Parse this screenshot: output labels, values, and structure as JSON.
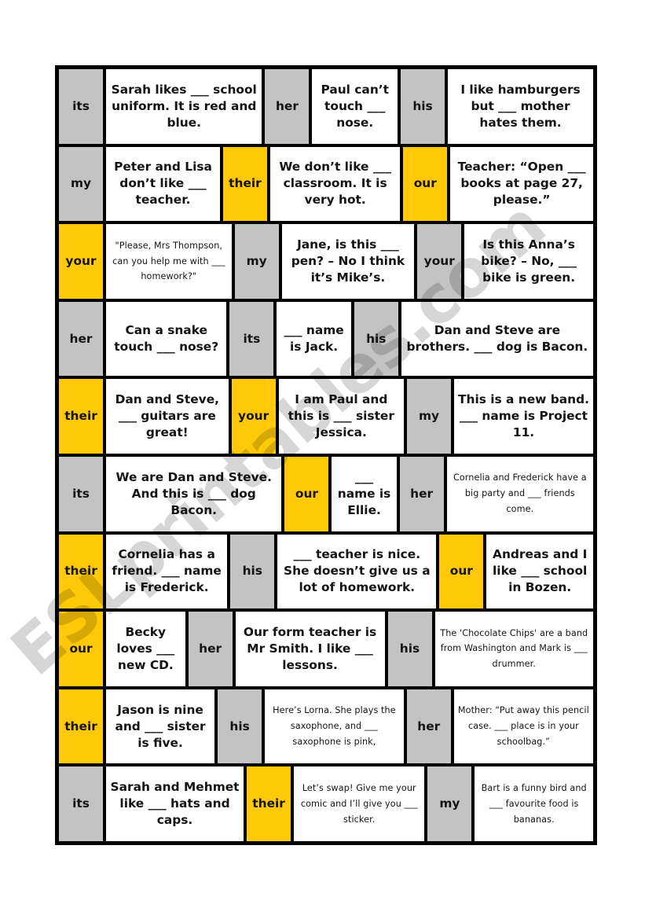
{
  "watermark": {
    "text": "ESLprintables.com"
  },
  "page": {
    "title": "Possessive adjectives domino / board cards",
    "colors": {
      "yellow": "#ffc907",
      "grey": "#c3c3c3",
      "border": "#000000",
      "white": "#ffffff"
    }
  },
  "board": {
    "columns": 6,
    "rows": [
      {
        "cells": [
          {
            "type": "word",
            "highlight": "grey",
            "text": "its"
          },
          {
            "type": "sentence",
            "size": "normal",
            "text": "Sarah likes ___ school uniform. It is red and blue."
          },
          {
            "type": "word",
            "highlight": "grey",
            "text": "her"
          },
          {
            "type": "sentence",
            "size": "normal",
            "text": "Paul can’t touch ___ nose."
          },
          {
            "type": "word",
            "highlight": "grey",
            "text": "his"
          },
          {
            "type": "sentence",
            "size": "normal",
            "text": "I like hamburgers but ___ mother hates them."
          }
        ]
      },
      {
        "cells": [
          {
            "type": "word",
            "highlight": "grey",
            "text": "my"
          },
          {
            "type": "sentence",
            "size": "normal",
            "text": "Peter and Lisa don’t like ___ teacher."
          },
          {
            "type": "word",
            "highlight": "yellow",
            "text": "their"
          },
          {
            "type": "sentence",
            "size": "normal",
            "text": "We don’t like ___ classroom. It is very hot."
          },
          {
            "type": "word",
            "highlight": "yellow",
            "text": "our"
          },
          {
            "type": "sentence",
            "size": "normal",
            "text": "Teacher: “Open ___ books at page 27, please.”"
          }
        ]
      },
      {
        "cells": [
          {
            "type": "word",
            "highlight": "yellow",
            "text": "your"
          },
          {
            "type": "sentence",
            "size": "small",
            "text": "\"Please, Mrs Thompson, can you help me with ___ homework?\""
          },
          {
            "type": "word",
            "highlight": "grey",
            "text": "my"
          },
          {
            "type": "sentence",
            "size": "normal",
            "text": "Jane, is this ___ pen? – No I think it’s Mike’s."
          },
          {
            "type": "word",
            "highlight": "grey",
            "text": "your"
          },
          {
            "type": "sentence",
            "size": "normal",
            "text": "Is this Anna’s bike? – No, ___ bike is green."
          }
        ]
      },
      {
        "cells": [
          {
            "type": "word",
            "highlight": "grey",
            "text": "her"
          },
          {
            "type": "sentence",
            "size": "normal",
            "text": "Can a snake touch ___ nose?"
          },
          {
            "type": "word",
            "highlight": "grey",
            "text": "its"
          },
          {
            "type": "sentence",
            "size": "normal",
            "text": "___ name is Jack."
          },
          {
            "type": "word",
            "highlight": "grey",
            "text": "his"
          },
          {
            "type": "sentence",
            "size": "normal",
            "text": "Dan and Steve are brothers. ___ dog is Bacon."
          }
        ]
      },
      {
        "cells": [
          {
            "type": "word",
            "highlight": "yellow",
            "text": "their"
          },
          {
            "type": "sentence",
            "size": "normal",
            "text": "Dan and Steve, ___ guitars are great!"
          },
          {
            "type": "word",
            "highlight": "yellow",
            "text": "your"
          },
          {
            "type": "sentence",
            "size": "normal",
            "text": "I am Paul and this is ___ sister Jessica."
          },
          {
            "type": "word",
            "highlight": "grey",
            "text": "my"
          },
          {
            "type": "sentence",
            "size": "normal",
            "text": "This is a new band. ___ name is Project 11."
          }
        ]
      },
      {
        "cells": [
          {
            "type": "word",
            "highlight": "grey",
            "text": "its"
          },
          {
            "type": "sentence",
            "size": "normal",
            "text": "We are Dan and Steve. And this is ___ dog Bacon."
          },
          {
            "type": "word",
            "highlight": "yellow",
            "text": "our"
          },
          {
            "type": "sentence",
            "size": "normal",
            "text": "___ name is Ellie."
          },
          {
            "type": "word",
            "highlight": "grey",
            "text": "her"
          },
          {
            "type": "sentence",
            "size": "small",
            "text": "Cornelia and Frederick have a big party and ___ friends come."
          }
        ]
      },
      {
        "cells": [
          {
            "type": "word",
            "highlight": "yellow",
            "text": "their"
          },
          {
            "type": "sentence",
            "size": "normal",
            "text": "Cornelia has a friend. ___ name is Frederick."
          },
          {
            "type": "word",
            "highlight": "grey",
            "text": "his"
          },
          {
            "type": "sentence",
            "size": "normal",
            "text": "___ teacher is nice. She doesn’t give us a lot of homework."
          },
          {
            "type": "word",
            "highlight": "yellow",
            "text": "our"
          },
          {
            "type": "sentence",
            "size": "normal",
            "text": "Andreas and I like ___ school in Bozen."
          }
        ]
      },
      {
        "cells": [
          {
            "type": "word",
            "highlight": "yellow",
            "text": "our"
          },
          {
            "type": "sentence",
            "size": "normal",
            "text": "Becky loves ___ new CD."
          },
          {
            "type": "word",
            "highlight": "grey",
            "text": "her"
          },
          {
            "type": "sentence",
            "size": "normal",
            "text": "Our form teacher is Mr Smith. I like ___ lessons."
          },
          {
            "type": "word",
            "highlight": "grey",
            "text": "his"
          },
          {
            "type": "sentence",
            "size": "small",
            "text": "The 'Chocolate Chips' are a band from Washington and Mark is ___ drummer."
          }
        ]
      },
      {
        "cells": [
          {
            "type": "word",
            "highlight": "yellow",
            "text": "their"
          },
          {
            "type": "sentence",
            "size": "normal",
            "text": "Jason is nine and ___ sister is five."
          },
          {
            "type": "word",
            "highlight": "grey",
            "text": "his"
          },
          {
            "type": "sentence",
            "size": "small",
            "text": "Here’s Lorna. She plays the saxophone, and ___ saxophone is pink,"
          },
          {
            "type": "word",
            "highlight": "grey",
            "text": "her"
          },
          {
            "type": "sentence",
            "size": "small",
            "text": "Mother: “Put away this pencil case. ___ place is in your schoolbag.”"
          }
        ]
      },
      {
        "cells": [
          {
            "type": "word",
            "highlight": "grey",
            "text": "its"
          },
          {
            "type": "sentence",
            "size": "normal",
            "text": "Sarah and Mehmet like ___ hats and caps."
          },
          {
            "type": "word",
            "highlight": "yellow",
            "text": "their"
          },
          {
            "type": "sentence",
            "size": "small",
            "text": "Let’s swap! Give me your comic and I’ll give you ___ sticker."
          },
          {
            "type": "word",
            "highlight": "grey",
            "text": "my"
          },
          {
            "type": "sentence",
            "size": "small",
            "text": "Bart is a funny bird and ___ favourite food is bananas."
          }
        ]
      }
    ]
  }
}
